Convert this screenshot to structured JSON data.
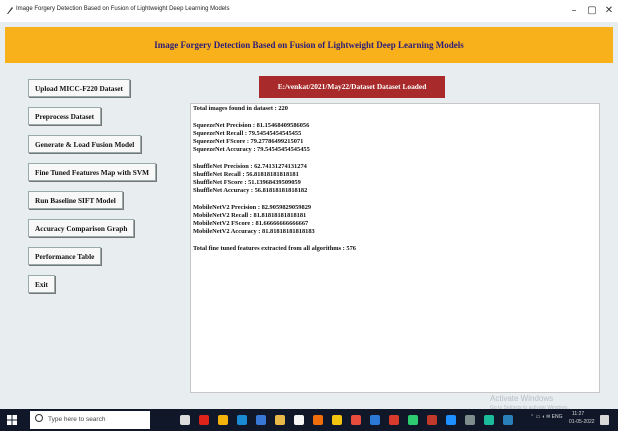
{
  "window": {
    "title": "Image Forgery Detection Based on Fusion of Lightweight Deep Learning Models",
    "minimize": "–",
    "maximize": "▢",
    "close": "✕"
  },
  "header": {
    "title": "Image Forgery Detection Based on Fusion of Lightweight Deep Learning Models"
  },
  "buttons": [
    "Upload MICC-F220 Dataset",
    "Preprocess Dataset",
    "Generate & Load Fusion Model",
    "Fine Tuned Features Map with SVM",
    "Run Baseline SIFT Model",
    "Accuracy Comparison Graph",
    "Performance Table",
    "Exit"
  ],
  "status": "E:/venkat/2021/May22/Dataset Dataset Loaded",
  "output": {
    "lines": [
      "Total images found in dataset : 220",
      "",
      "SqueezeNet Precision : 81.15468409586056",
      "SqueezeNet Recall   : 79.54545454545455",
      "SqueezeNet FScore   : 79.27786499215071",
      "SqueezeNet Accuracy  : 79.54545454545455",
      "",
      "ShuffleNet Precision : 62.74131274131274",
      "ShuffleNet Recall   : 56.81818181818181",
      "ShuffleNet FScore   : 51.13968439509059",
      "ShuffleNet Accuracy  : 56.81818181818182",
      "",
      "MobileNetV2 Precision : 82.9059829059829",
      "MobileNetV2 Recall   : 81.81818181818181",
      "MobileNetV2 FScore   : 81.66666666666667",
      "MobileNetV2 Accuracy  : 81.81818181818183",
      "",
      "Total fine tuned features extracted from all algorithms : 576"
    ]
  },
  "watermark": {
    "title": "Activate Windows",
    "subtitle": "Go to Settings to activate Windows."
  },
  "taskbar": {
    "search_placeholder": "Type here to search",
    "time": "11:27",
    "date": "01-05-2022",
    "icons": [
      "task-view-icon",
      "opera-icon",
      "chrome-icon",
      "edge-icon",
      "store-icon",
      "files-icon",
      "app-icon",
      "app-icon",
      "app-icon",
      "app-icon",
      "app-icon",
      "app-icon",
      "app-icon",
      "app-icon",
      "app-icon",
      "app-icon",
      "app-icon",
      "app-icon"
    ],
    "icon_colors": [
      "#ddd",
      "#e0231a",
      "#f2b40b",
      "#1a8ad4",
      "#3a78d8",
      "#e9b84a",
      "#f5f5f5",
      "#f06d0c",
      "#f1c40f",
      "#e84c3d",
      "#2b78d6",
      "#d83b2b",
      "#2ecc71",
      "#c0392b",
      "#1e90ff",
      "#7f8c8d",
      "#1abc9c",
      "#2980b9"
    ]
  }
}
